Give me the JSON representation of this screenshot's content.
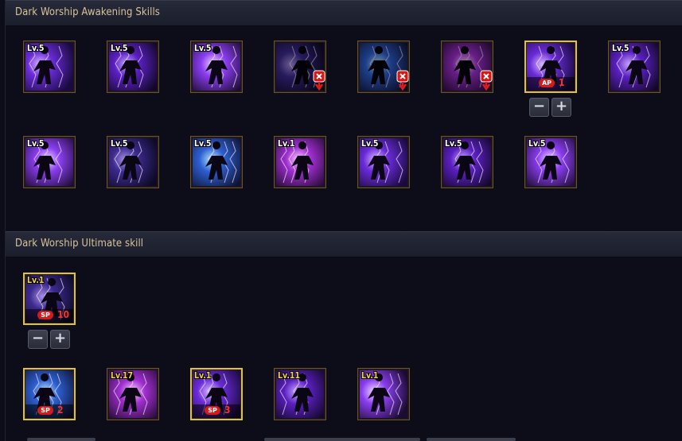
{
  "sections": {
    "awakening": {
      "title": "Dark Worship Awakening Skills"
    },
    "ultimate": {
      "title": "Dark Worship Ultimate skill"
    }
  },
  "awakening_row1": [
    {
      "level": "Lv.5",
      "icon": "sliding-kick-skill-icon"
    },
    {
      "level": "Lv.5",
      "icon": "lightning-aura-skill-icon"
    },
    {
      "level": "Lv.5",
      "icon": "lightning-stance-skill-icon"
    },
    {
      "icon": "dash-strike-skill-icon",
      "locked": true
    },
    {
      "icon": "shadow-slide-skill-icon",
      "locked": true
    },
    {
      "icon": "lightning-burst-skill-icon",
      "locked": true
    },
    {
      "icon": "fist-skill-icon",
      "cost_type": "AP",
      "cost": "1"
    },
    {
      "level": "Lv.5",
      "icon": "palm-strike-skill-icon"
    }
  ],
  "awakening_row2": [
    {
      "level": "Lv.5",
      "icon": "rising-kick-skill-icon"
    },
    {
      "level": "Lv.5",
      "icon": "ground-slash-skill-icon"
    },
    {
      "level": "Lv.5",
      "icon": "water-burst-skill-icon"
    },
    {
      "level": "Lv.1",
      "icon": "blue-flash-skill-icon"
    },
    {
      "level": "Lv.5",
      "icon": "thunder-stance-skill-icon"
    },
    {
      "level": "Lv.5",
      "icon": "sky-leap-skill-icon"
    },
    {
      "level": "Lv.5",
      "icon": "dark-orb-skill-icon"
    }
  ],
  "ultimate_main": {
    "level": "Lv.1",
    "icon": "black-hole-skill-icon",
    "cost_type": "SP",
    "cost": "10"
  },
  "ultimate_row": [
    {
      "icon": "shadow-grapple-skill-icon",
      "cost_type": "SP",
      "cost": "2"
    },
    {
      "level": "Lv.17",
      "icon": "power-fist-skill-icon"
    },
    {
      "level": "Lv.1",
      "icon": "arc-slash-skill-icon",
      "cost_type": "SP",
      "cost": "3"
    },
    {
      "level": "Lv.11",
      "icon": "energy-sphere-skill-icon"
    },
    {
      "level": "Lv.1",
      "icon": "power-up-skill-icon"
    }
  ],
  "stepper": {
    "minus": "−",
    "plus": "+"
  }
}
